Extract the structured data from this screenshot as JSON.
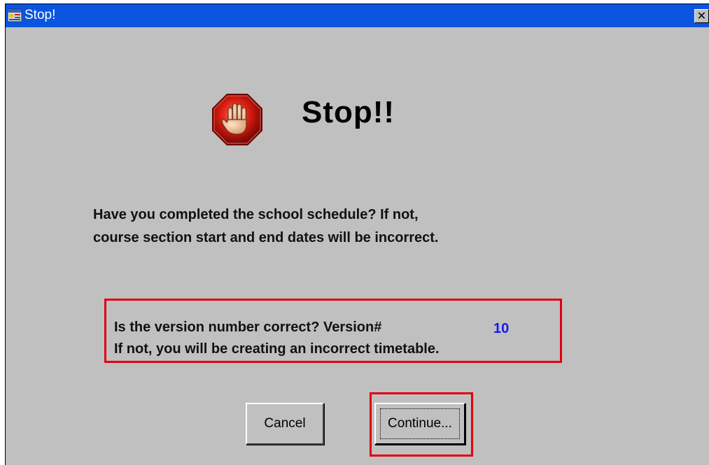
{
  "window": {
    "title": "Stop!",
    "close_label": "✕"
  },
  "dialog": {
    "heading": "Stop!!",
    "schedule_line1": "Have you completed the school schedule?  If not,",
    "schedule_line2": "course section start and end dates will be incorrect.",
    "version_line1": "Is the version number correct?  Version#",
    "version_number": "10",
    "version_line2": "If not, you will be creating an incorrect timetable."
  },
  "buttons": {
    "cancel_label": "Cancel",
    "continue_label": "Continue..."
  },
  "colors": {
    "titlebar": "#0a55e0",
    "face": "#c0c0c0",
    "highlight": "#e00010",
    "version_number": "#1a1ae6"
  },
  "icons": {
    "app": "app-window-icon",
    "stop": "stop-hand-icon",
    "close": "close-icon"
  }
}
